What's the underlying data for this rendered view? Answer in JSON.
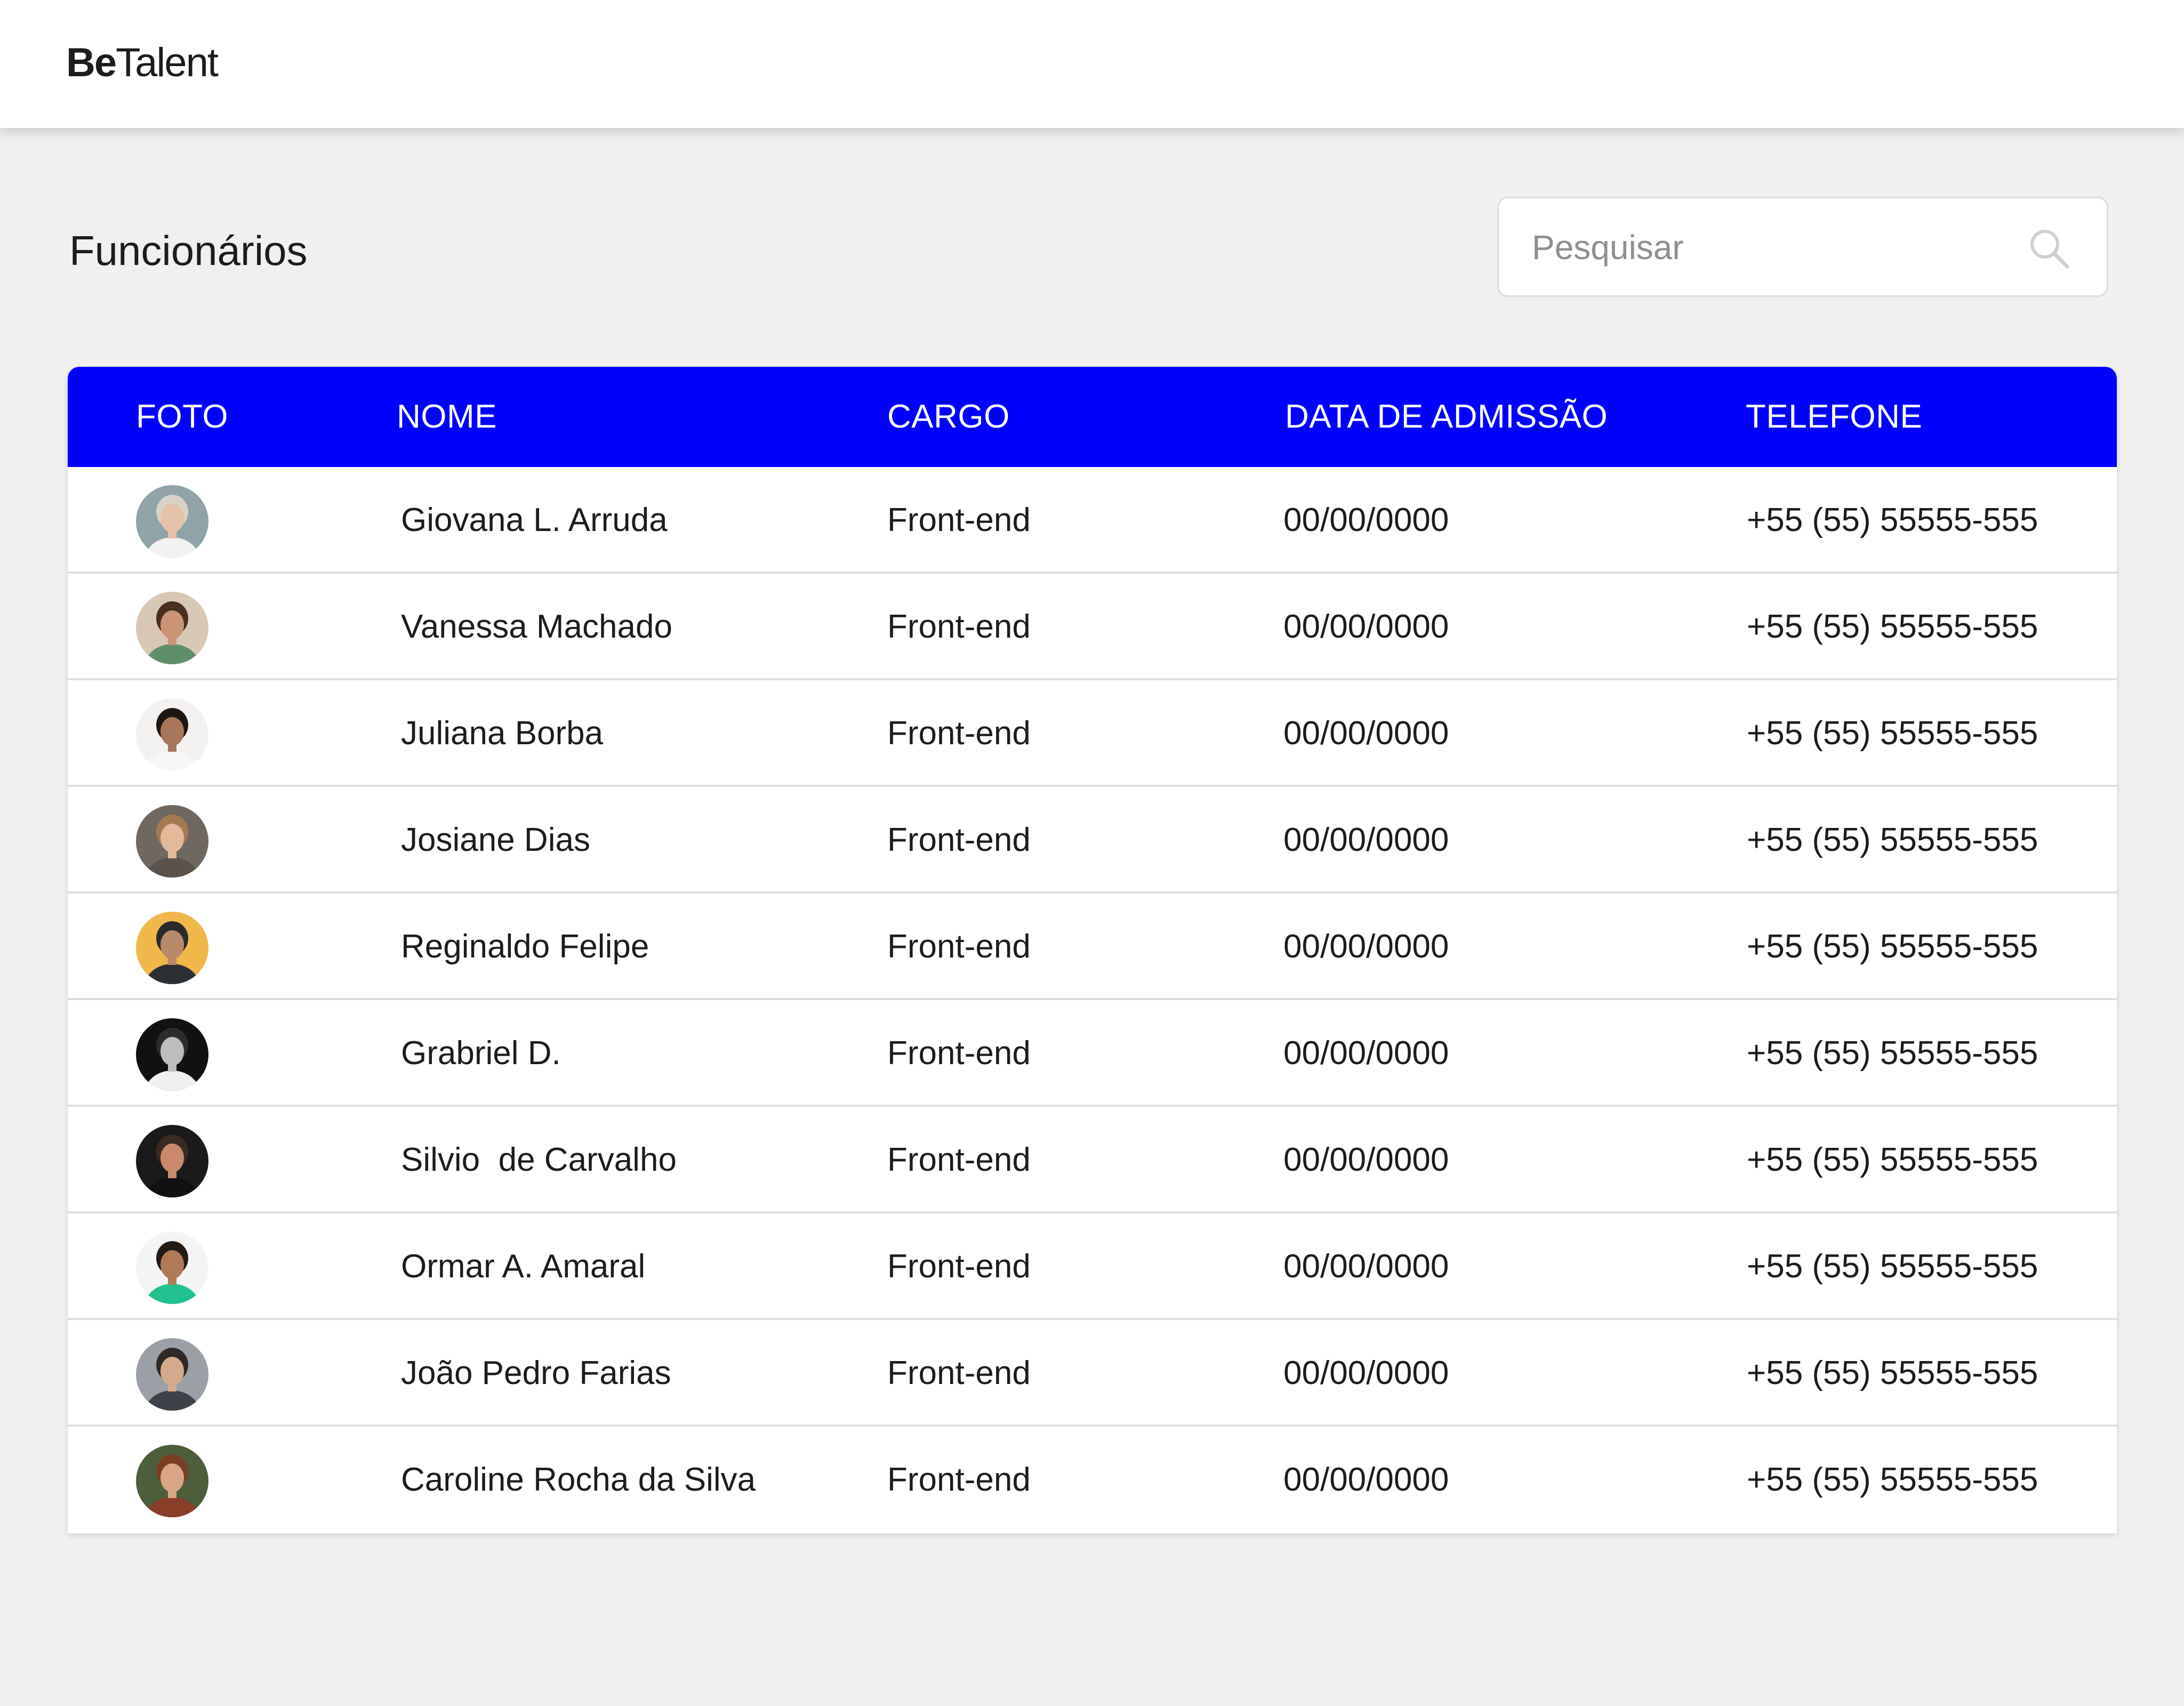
{
  "header": {
    "logo_bold": "Be",
    "logo_regular": "Talent"
  },
  "page": {
    "title": "Funcionários"
  },
  "search": {
    "placeholder": "Pesquisar",
    "value": "",
    "icon": "search-icon"
  },
  "table": {
    "columns": [
      "FOTO",
      "NOME",
      "CARGO",
      "DATA DE ADMISSÃO",
      "TELEFONE"
    ],
    "rows": [
      {
        "nome": "Giovana L. Arruda",
        "cargo": "Front-end",
        "data": "00/00/0000",
        "telefone": "+55 (55) 55555-555",
        "avatar_bg": "#8fa3a8",
        "avatar_skin": "#e6c3a8",
        "avatar_hair": "#d9d2c6",
        "avatar_shirt": "#f2f2f2"
      },
      {
        "nome": "Vanessa Machado",
        "cargo": "Front-end",
        "data": "00/00/0000",
        "telefone": "+55 (55) 55555-555",
        "avatar_bg": "#d8c7b3",
        "avatar_skin": "#c99575",
        "avatar_hair": "#4a2e1f",
        "avatar_shirt": "#5d8f6b"
      },
      {
        "nome": "Juliana Borba",
        "cargo": "Front-end",
        "data": "00/00/0000",
        "telefone": "+55 (55) 55555-555",
        "avatar_bg": "#f4f2f0",
        "avatar_skin": "#a9765a",
        "avatar_hair": "#1e1612",
        "avatar_shirt": "#f7f7f7"
      },
      {
        "nome": "Josiane Dias",
        "cargo": "Front-end",
        "data": "00/00/0000",
        "telefone": "+55 (55) 55555-555",
        "avatar_bg": "#6f6860",
        "avatar_skin": "#e2b99a",
        "avatar_hair": "#a57a4e",
        "avatar_shirt": "#5a524c"
      },
      {
        "nome": "Reginaldo Felipe",
        "cargo": "Front-end",
        "data": "00/00/0000",
        "telefone": "+55 (55) 55555-555",
        "avatar_bg": "#f0b84a",
        "avatar_skin": "#b98a6a",
        "avatar_hair": "#2a2a2a",
        "avatar_shirt": "#2b3035"
      },
      {
        "nome": "Grabriel D.",
        "cargo": "Front-end",
        "data": "00/00/0000",
        "telefone": "+55 (55) 55555-555",
        "avatar_bg": "#111111",
        "avatar_skin": "#bdbdbd",
        "avatar_hair": "#2c2c2c",
        "avatar_shirt": "#f0f0f0"
      },
      {
        "nome": "Silvio  de Carvalho",
        "cargo": "Front-end",
        "data": "00/00/0000",
        "telefone": "+55 (55) 55555-555",
        "avatar_bg": "#1a1a1a",
        "avatar_skin": "#c98a6b",
        "avatar_hair": "#3a2a22",
        "avatar_shirt": "#111111"
      },
      {
        "nome": "Ormar A. Amaral",
        "cargo": "Front-end",
        "data": "00/00/0000",
        "telefone": "+55 (55) 55555-555",
        "avatar_bg": "#f4f4f4",
        "avatar_skin": "#b07a55",
        "avatar_hair": "#241a14",
        "avatar_shirt": "#21c28f"
      },
      {
        "nome": "João Pedro Farias",
        "cargo": "Front-end",
        "data": "00/00/0000",
        "telefone": "+55 (55) 55555-555",
        "avatar_bg": "#9aa0a6",
        "avatar_skin": "#d6a98b",
        "avatar_hair": "#2f2a26",
        "avatar_shirt": "#3c4248"
      },
      {
        "nome": "Caroline Rocha da Silva",
        "cargo": "Front-end",
        "data": "00/00/0000",
        "telefone": "+55 (55) 55555-555",
        "avatar_bg": "#4d5e3a",
        "avatar_skin": "#d9a585",
        "avatar_hair": "#7a3f22",
        "avatar_shirt": "#8a3d28"
      }
    ]
  },
  "colors": {
    "accent": "#0000ff",
    "background": "#f0f0f0",
    "surface": "#ffffff",
    "text": "#1c1c1c",
    "divider": "#dedede"
  }
}
